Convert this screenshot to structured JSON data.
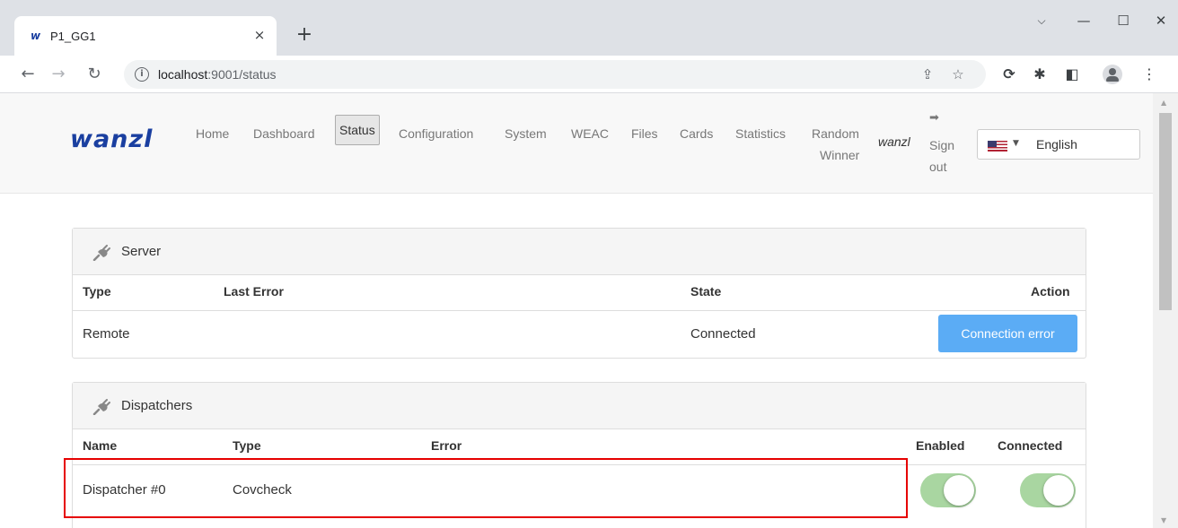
{
  "browser": {
    "tab": {
      "favicon": "w",
      "title": "P1_GG1",
      "close": "×"
    },
    "new_tab": "+",
    "window_controls": {
      "chevron": "⌵",
      "minimize": "—",
      "maximize": "☐",
      "close": "✕"
    },
    "url_prefix": "localhost",
    "url_rest": ":9001/status"
  },
  "app": {
    "logo": "wanzl",
    "nav": [
      {
        "label": "Home"
      },
      {
        "label": "Dashboard"
      },
      {
        "label": "Status"
      },
      {
        "label": "Configuration"
      },
      {
        "label": "System"
      },
      {
        "label": "WEAC"
      },
      {
        "label": "Files"
      },
      {
        "label": "Cards"
      },
      {
        "label": "Statistics"
      },
      {
        "label": "Random"
      },
      {
        "label": "Winner"
      }
    ],
    "user": "wanzl",
    "sign_out_line1": "Sign",
    "sign_out_line2": "out",
    "language": "English"
  },
  "server_panel": {
    "title": "Server",
    "headers": {
      "type": "Type",
      "last_error": "Last Error",
      "state": "State",
      "action": "Action"
    },
    "row": {
      "type": "Remote",
      "last_error": "",
      "state": "Connected",
      "action": "Connection error"
    }
  },
  "dispatchers_panel": {
    "title": "Dispatchers",
    "headers": {
      "name": "Name",
      "type": "Type",
      "error": "Error",
      "enabled": "Enabled",
      "connected": "Connected"
    },
    "row": {
      "name": "Dispatcher #0",
      "type": "Covcheck",
      "error": "",
      "enabled": true,
      "connected": true
    }
  },
  "colors": {
    "brand": "#1a3fa0",
    "button": "#5bacf5",
    "toggle_on": "#a9d6a1",
    "highlight": "#e60000"
  }
}
